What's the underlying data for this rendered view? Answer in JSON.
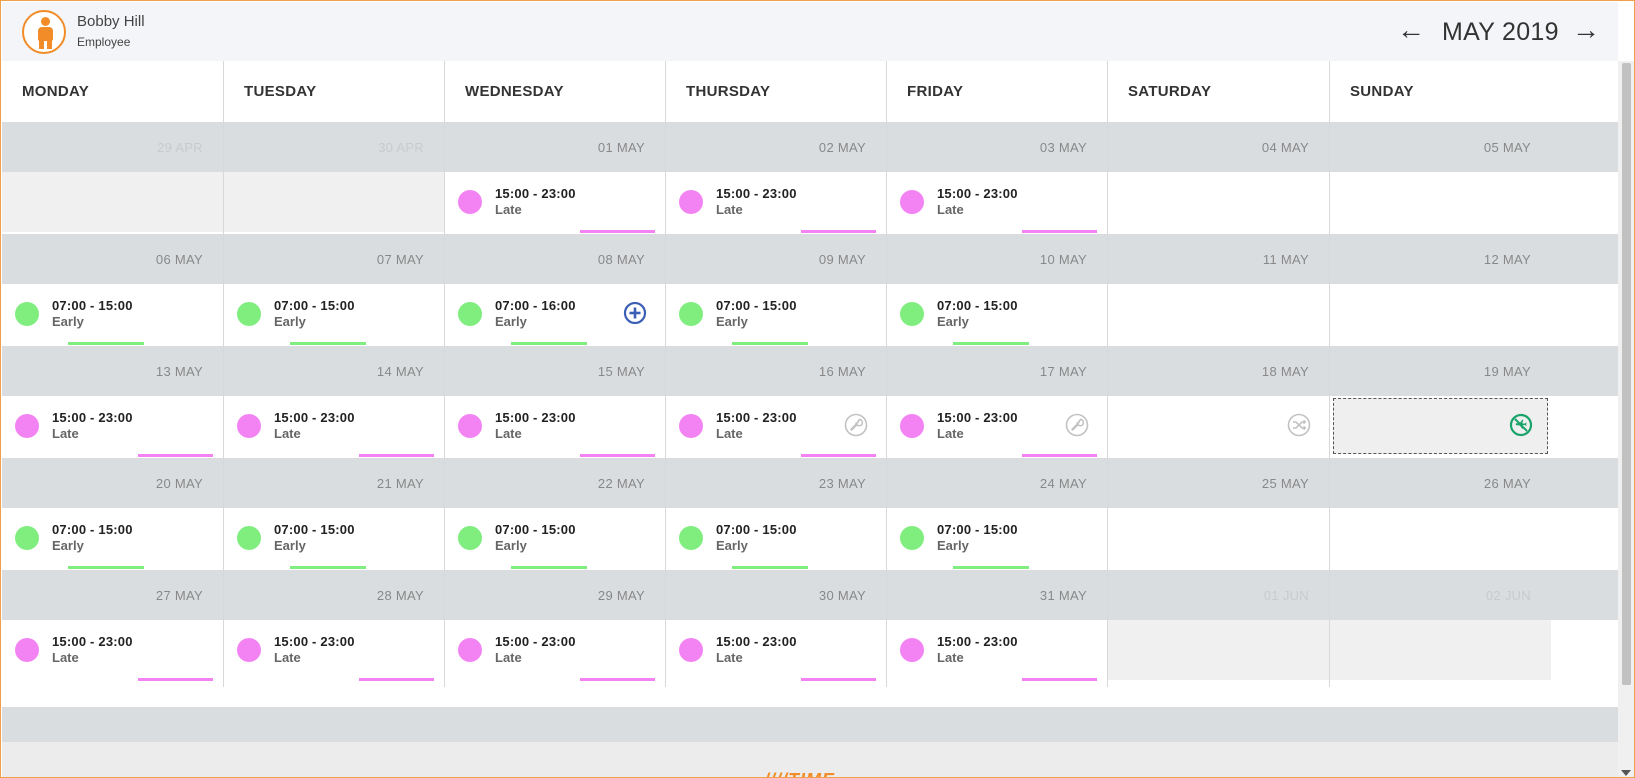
{
  "user": {
    "name": "Bobby Hill",
    "role": "Employee"
  },
  "nav": {
    "month_title": "MAY 2019",
    "prev_glyph": "←",
    "next_glyph": "→"
  },
  "days": [
    "MONDAY",
    "TUESDAY",
    "WEDNESDAY",
    "THURSDAY",
    "FRIDAY",
    "SATURDAY",
    "SUNDAY"
  ],
  "colors": {
    "accent": "#f28c28",
    "late": "#f383f3",
    "early": "#7fee7f",
    "band": "#dadde0",
    "add_icon": "#3a5fb5",
    "sunday_icon": "#1aa36a"
  },
  "weeks": [
    {
      "cells": [
        {
          "date": "29 APR",
          "other": true,
          "disabled": true
        },
        {
          "date": "30 APR",
          "other": true,
          "disabled": true
        },
        {
          "date": "01 MAY",
          "shift": {
            "time": "15:00 - 23:00",
            "type": "Late",
            "kind": "late"
          }
        },
        {
          "date": "02 MAY",
          "shift": {
            "time": "15:00 - 23:00",
            "type": "Late",
            "kind": "late"
          }
        },
        {
          "date": "03 MAY",
          "shift": {
            "time": "15:00 - 23:00",
            "type": "Late",
            "kind": "late"
          }
        },
        {
          "date": "04 MAY"
        },
        {
          "date": "05 MAY"
        }
      ]
    },
    {
      "cells": [
        {
          "date": "06 MAY",
          "shift": {
            "time": "07:00 - 15:00",
            "type": "Early",
            "kind": "early"
          }
        },
        {
          "date": "07 MAY",
          "shift": {
            "time": "07:00 - 15:00",
            "type": "Early",
            "kind": "early"
          }
        },
        {
          "date": "08 MAY",
          "shift": {
            "time": "07:00 - 16:00",
            "type": "Early",
            "kind": "early"
          },
          "icon": "add-circle-icon"
        },
        {
          "date": "09 MAY",
          "shift": {
            "time": "07:00 - 15:00",
            "type": "Early",
            "kind": "early"
          }
        },
        {
          "date": "10 MAY",
          "shift": {
            "time": "07:00 - 15:00",
            "type": "Early",
            "kind": "early"
          }
        },
        {
          "date": "11 MAY"
        },
        {
          "date": "12 MAY"
        }
      ]
    },
    {
      "cells": [
        {
          "date": "13 MAY",
          "shift": {
            "time": "15:00 - 23:00",
            "type": "Late",
            "kind": "late"
          }
        },
        {
          "date": "14 MAY",
          "shift": {
            "time": "15:00 - 23:00",
            "type": "Late",
            "kind": "late"
          }
        },
        {
          "date": "15 MAY",
          "shift": {
            "time": "15:00 - 23:00",
            "type": "Late",
            "kind": "late"
          }
        },
        {
          "date": "16 MAY",
          "shift": {
            "time": "15:00 - 23:00",
            "type": "Late",
            "kind": "late"
          },
          "icon": "wrench-icon"
        },
        {
          "date": "17 MAY",
          "shift": {
            "time": "15:00 - 23:00",
            "type": "Late",
            "kind": "late"
          },
          "icon": "wrench-icon"
        },
        {
          "date": "18 MAY",
          "icon": "shuffle-icon"
        },
        {
          "date": "19 MAY",
          "icon": "no-flight-icon",
          "selected": true
        }
      ]
    },
    {
      "cells": [
        {
          "date": "20 MAY",
          "shift": {
            "time": "07:00 - 15:00",
            "type": "Early",
            "kind": "early"
          }
        },
        {
          "date": "21 MAY",
          "shift": {
            "time": "07:00 - 15:00",
            "type": "Early",
            "kind": "early"
          }
        },
        {
          "date": "22 MAY",
          "shift": {
            "time": "07:00 - 15:00",
            "type": "Early",
            "kind": "early"
          }
        },
        {
          "date": "23 MAY",
          "shift": {
            "time": "07:00 - 15:00",
            "type": "Early",
            "kind": "early"
          }
        },
        {
          "date": "24 MAY",
          "shift": {
            "time": "07:00 - 15:00",
            "type": "Early",
            "kind": "early"
          }
        },
        {
          "date": "25 MAY"
        },
        {
          "date": "26 MAY"
        }
      ]
    },
    {
      "cells": [
        {
          "date": "27 MAY",
          "shift": {
            "time": "15:00 - 23:00",
            "type": "Late",
            "kind": "late"
          }
        },
        {
          "date": "28 MAY",
          "shift": {
            "time": "15:00 - 23:00",
            "type": "Late",
            "kind": "late"
          }
        },
        {
          "date": "29 MAY",
          "shift": {
            "time": "15:00 - 23:00",
            "type": "Late",
            "kind": "late"
          }
        },
        {
          "date": "30 MAY",
          "shift": {
            "time": "15:00 - 23:00",
            "type": "Late",
            "kind": "late"
          }
        },
        {
          "date": "31 MAY",
          "shift": {
            "time": "15:00 - 23:00",
            "type": "Late",
            "kind": "late"
          }
        },
        {
          "date": "01 JUN",
          "other": true,
          "disabled": true
        },
        {
          "date": "02 JUN",
          "other": true,
          "disabled": true
        }
      ]
    }
  ],
  "footer": {
    "logo_text": "////TIME"
  }
}
